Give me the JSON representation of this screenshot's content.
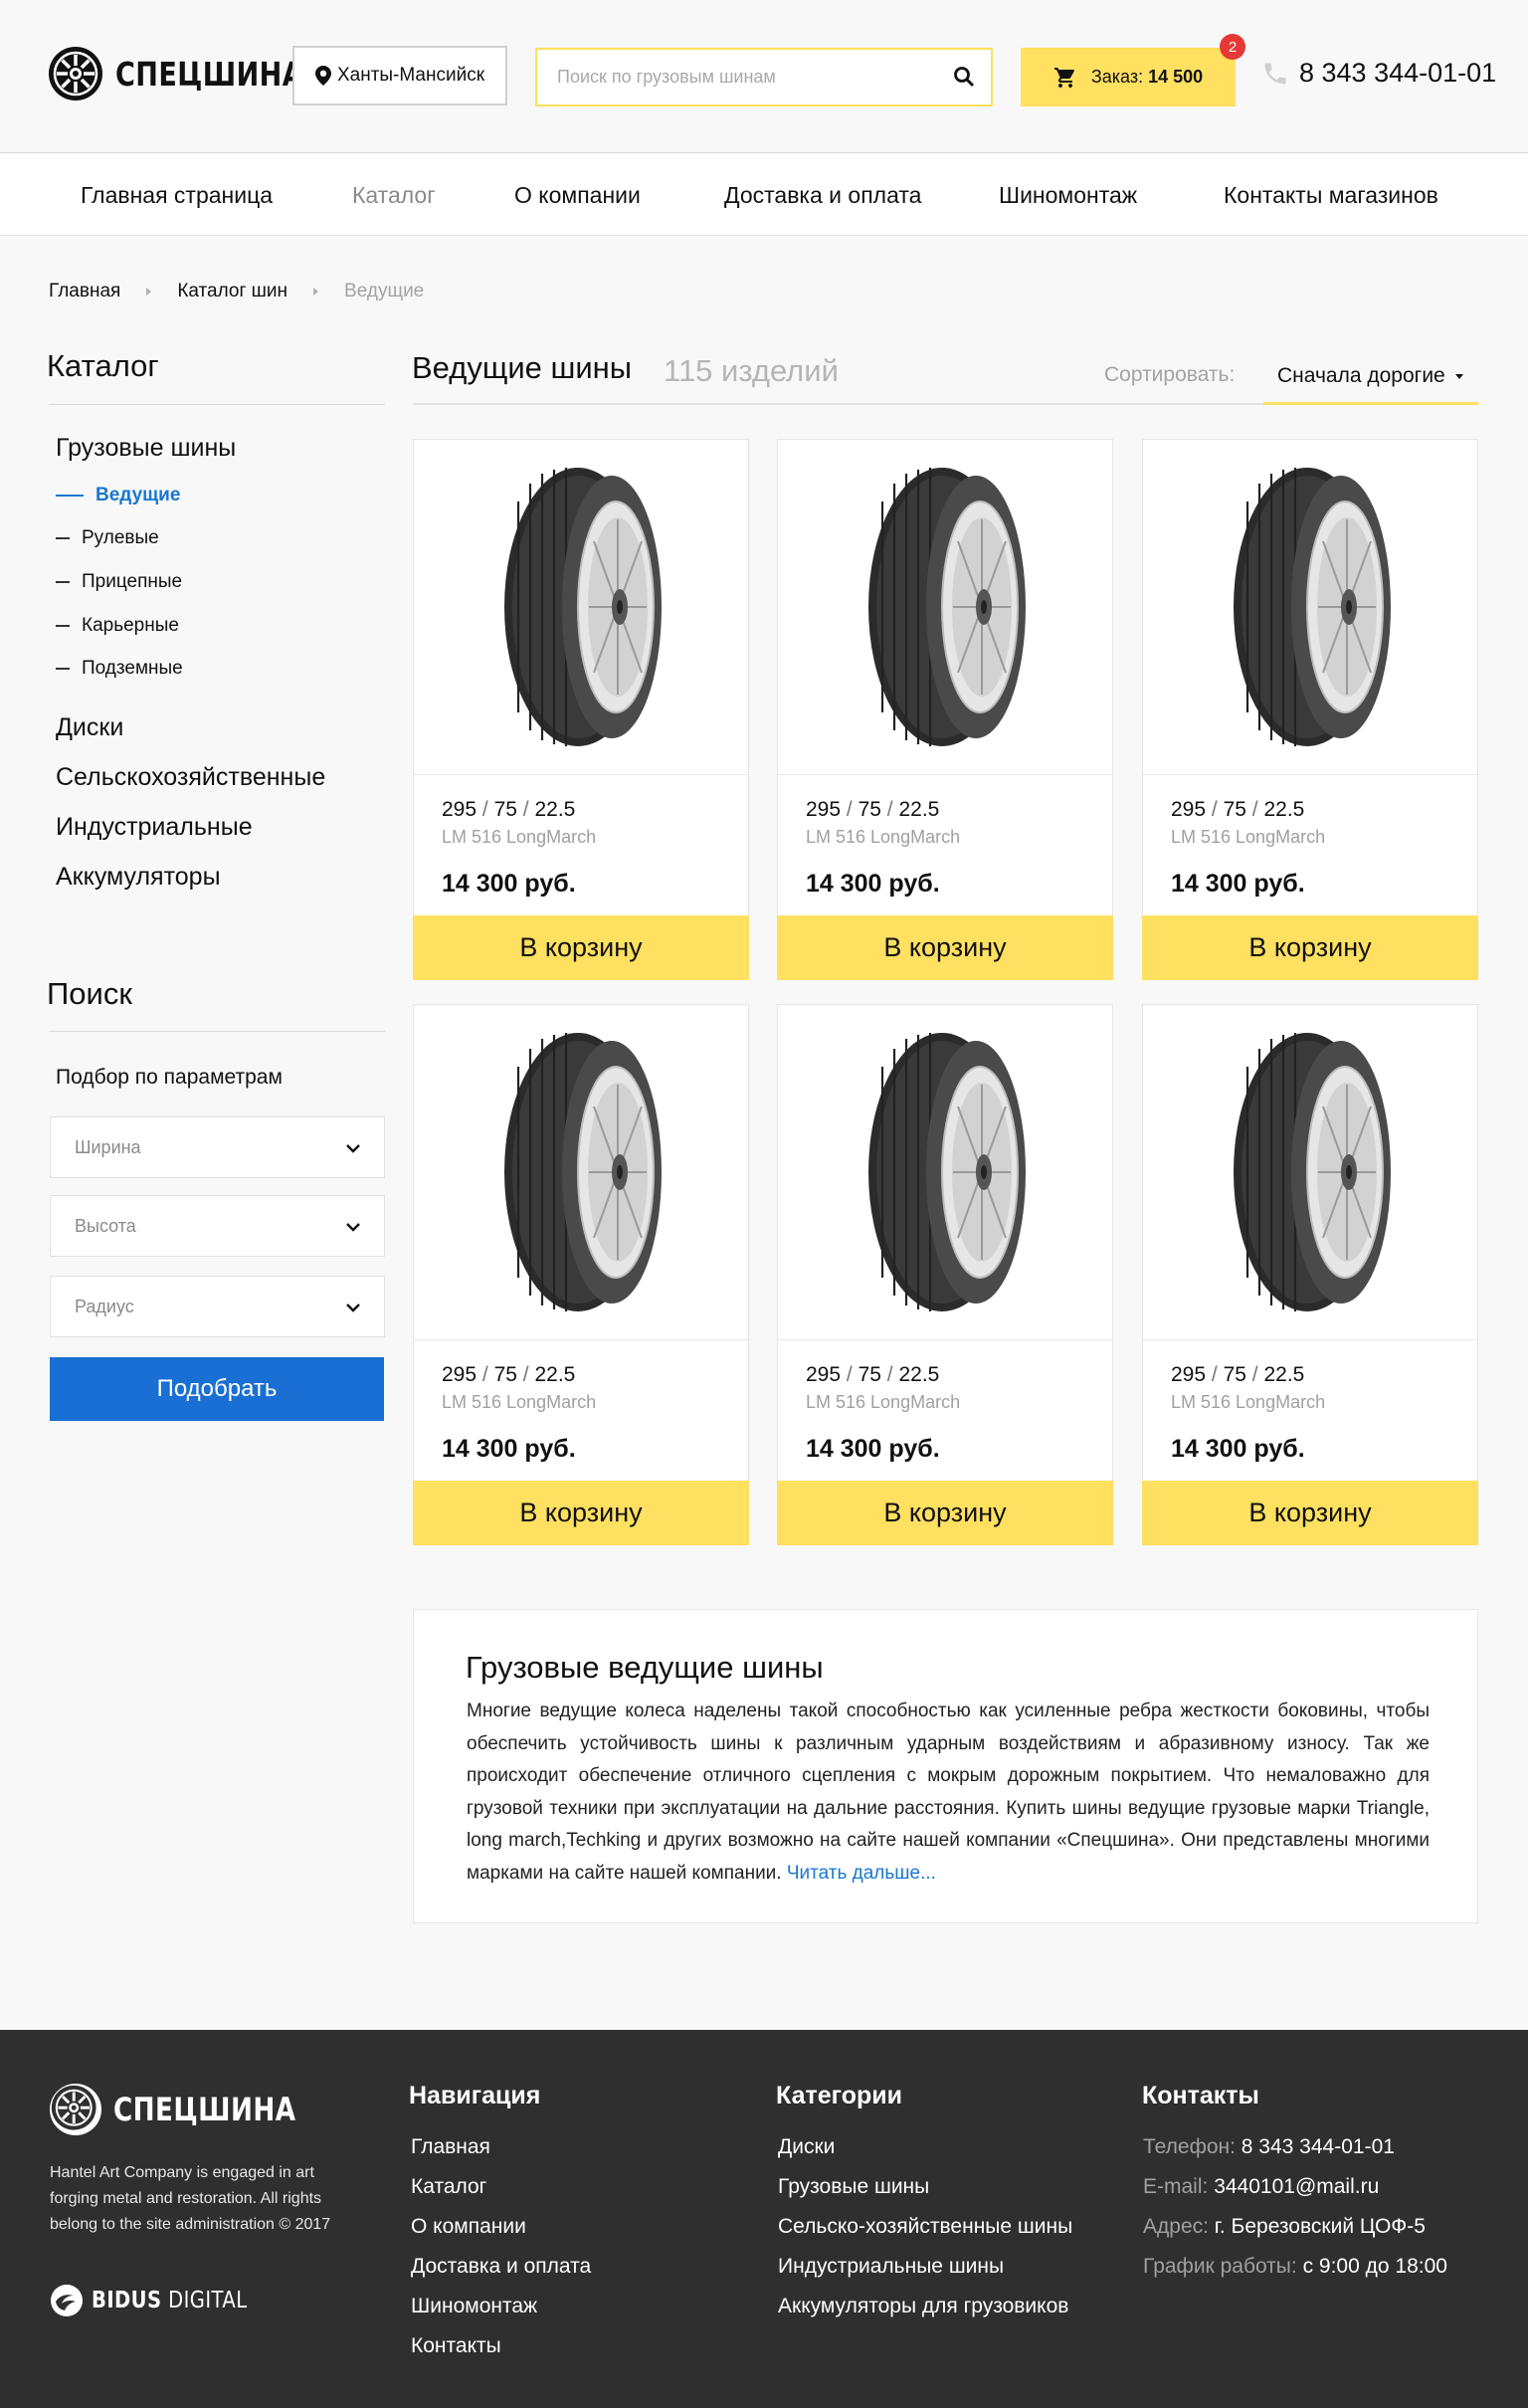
{
  "header": {
    "logo_text": "СПЕЦШИНА",
    "city": "Ханты-Мансийск",
    "search_placeholder": "Поиск по грузовым шинам",
    "cart_label": "Заказ:",
    "cart_amount": "14 500",
    "cart_badge": "2",
    "phone": "8 343 344-01-01"
  },
  "nav": {
    "items": [
      {
        "label": "Главная страница"
      },
      {
        "label": "Каталог"
      },
      {
        "label": "О компании"
      },
      {
        "label": "Доставка и оплата"
      },
      {
        "label": "Шиномонтаж"
      },
      {
        "label": "Контакты магазинов"
      }
    ],
    "active_index": 1
  },
  "breadcrumb": [
    "Главная",
    "Каталог шин",
    "Ведущие"
  ],
  "sidebar": {
    "catalog_title": "Каталог",
    "truck_tires": "Грузовые шины",
    "subcategories": [
      "Ведущие",
      "Рулевые",
      "Прицепные",
      "Карьерные",
      "Подземные"
    ],
    "active_sub": "Ведущие",
    "categories": [
      "Диски",
      "Сельскохозяйственные",
      "Индустриальные",
      "Аккумуляторы"
    ],
    "search_title": "Поиск",
    "filter_label": "Подбор по параметрам",
    "selects": [
      "Ширина",
      "Высота",
      "Радиус"
    ],
    "pick_button": "Подобрать"
  },
  "main": {
    "title": "Ведущие шины",
    "count": "115 изделий",
    "sort_label": "Сортировать:",
    "sort_value": "Сначала дорогие"
  },
  "products": [
    {
      "width": "295",
      "height": "75",
      "radius": "22.5",
      "model": "LM 516 LongMarch",
      "price": "14 300 руб.",
      "button": "В корзину"
    },
    {
      "width": "295",
      "height": "75",
      "radius": "22.5",
      "model": "LM 516 LongMarch",
      "price": "14 300 руб.",
      "button": "В корзину"
    },
    {
      "width": "295",
      "height": "75",
      "radius": "22.5",
      "model": "LM 516 LongMarch",
      "price": "14 300 руб.",
      "button": "В корзину"
    },
    {
      "width": "295",
      "height": "75",
      "radius": "22.5",
      "model": "LM 516 LongMarch",
      "price": "14 300 руб.",
      "button": "В корзину"
    },
    {
      "width": "295",
      "height": "75",
      "radius": "22.5",
      "model": "LM 516 LongMarch",
      "price": "14 300 руб.",
      "button": "В корзину"
    },
    {
      "width": "295",
      "height": "75",
      "radius": "22.5",
      "model": "LM 516 LongMarch",
      "price": "14 300 руб.",
      "button": "В корзину"
    }
  ],
  "seo": {
    "title": "Грузовые ведущие шины",
    "text": "Многие ведущие колеса наделены такой способностью как усиленные ребра жесткости боковины, чтобы обеспечить устойчивость шины к различным ударным воздействиям и абразивному износу. Так же происходит обеспечение отличного сцепления с мокрым дорожным покрытием. Что немаловажно для грузовой техники при эксплуатации на дальние расстояния. Купить шины ведущие грузовые марки Triangle, long march,Techking и других возможно на сайте нашей компании «Спецшина». Они представлены многими марками на сайте нашей компании.",
    "read_more": "Читать дальше..."
  },
  "footer": {
    "logo_text": "СПЕЦШИНА",
    "about": "Hantel Art Company is engaged in art forging metal and restoration. All rights belong to the site administration © 2017",
    "brand_bold": "BIDUS",
    "brand_rest": "DIGITAL",
    "nav_title": "Навигация",
    "nav_links": [
      "Главная",
      "Каталог",
      "О компании",
      "Доставка и оплата",
      "Шиномонтаж",
      "Контакты"
    ],
    "cat_title": "Категории",
    "cat_links": [
      "Диски",
      "Грузовые шины",
      "Сельско-хозяйственные шины",
      "Индустриальные шины",
      "Аккумуляторы для грузовиков"
    ],
    "contacts_title": "Контакты",
    "contacts": [
      {
        "key": "Телефон:",
        "value": "8 343 344-01-01"
      },
      {
        "key": "E-mail:",
        "value": "3440101@mail.ru"
      },
      {
        "key": "Адрес:",
        "value": "г. Березовский ЦОФ-5"
      },
      {
        "key": "График работы:",
        "value": "с 9:00 до 18:00"
      }
    ]
  },
  "colors": {
    "accent_yellow": "#ffe060",
    "primary_blue": "#1a6fd4",
    "link_blue": "#1976d2",
    "badge_red": "#e53935",
    "footer_bg": "#2f2f2f"
  }
}
